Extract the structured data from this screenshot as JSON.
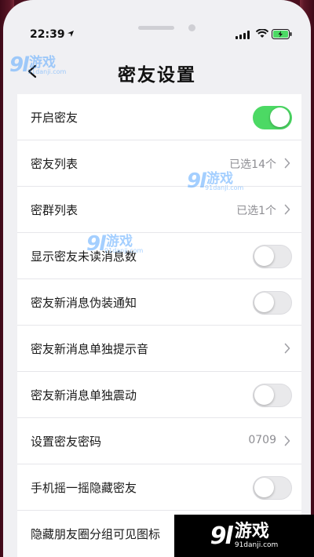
{
  "status_bar": {
    "time": "22:39"
  },
  "nav": {
    "title": "密友设置"
  },
  "settings": [
    {
      "label": "开启密友",
      "control": "toggle",
      "on": true
    },
    {
      "label": "密友列表",
      "control": "value",
      "value": "已选14个"
    },
    {
      "label": "密群列表",
      "control": "value",
      "value": "已选1个"
    },
    {
      "label": "显示密友未读消息数",
      "control": "toggle",
      "on": false
    },
    {
      "label": "密友新消息伪装通知",
      "control": "toggle",
      "on": false
    },
    {
      "label": "密友新消息单独提示音",
      "control": "chevron"
    },
    {
      "label": "密友新消息单独震动",
      "control": "toggle",
      "on": false
    },
    {
      "label": "设置密友密码",
      "control": "value",
      "value": "0709"
    },
    {
      "label": "手机摇一摇隐藏密友",
      "control": "toggle",
      "on": false
    },
    {
      "label": "隐藏朋友圈分组可见图标",
      "control": "none"
    }
  ],
  "watermark": {
    "number": "9l",
    "text": "游戏",
    "url": "91danji.com"
  },
  "colors": {
    "toggle_on": "#4cd964",
    "accent_watermark": "#5aa8ff"
  }
}
